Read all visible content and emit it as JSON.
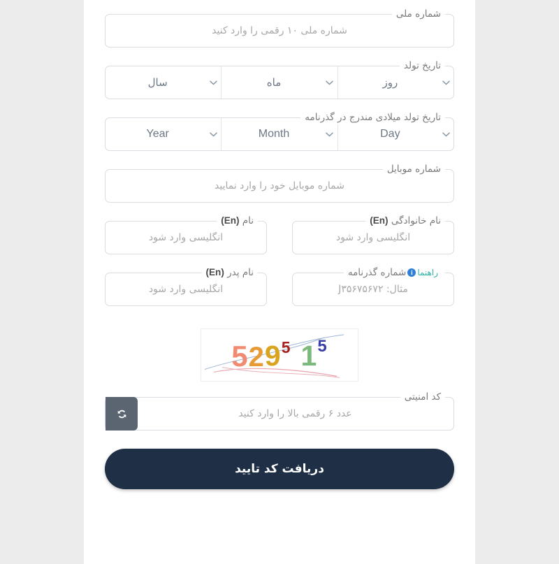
{
  "form": {
    "national_id": {
      "label": "شماره ملی",
      "placeholder": "شماره ملی ۱۰ رقمی را وارد کنید",
      "value": ""
    },
    "birth_date": {
      "label": "تاریخ تولد",
      "day": "روز",
      "month": "ماه",
      "year": "سال"
    },
    "passport_birth_date": {
      "label": "تاریخ تولد میلادی مندرج در گذرنامه",
      "day": "Day",
      "month": "Month",
      "year": "Year"
    },
    "mobile": {
      "label": "شماره موبایل",
      "placeholder": "شماره موبایل خود را وارد نمایید",
      "value": ""
    },
    "first_name_en": {
      "label_fa": "نام ",
      "label_en": "(En)",
      "placeholder": "انگلیسی وارد شود",
      "value": ""
    },
    "last_name_en": {
      "label_fa": "نام خانوادگی ",
      "label_en": "(En)",
      "placeholder": "انگلیسی وارد شود",
      "value": ""
    },
    "father_name_en": {
      "label_fa": "نام پدر ",
      "label_en": "(En)",
      "placeholder": "انگلیسی وارد شود",
      "value": ""
    },
    "passport_number": {
      "label": "شماره گذرنامه",
      "guide_link": "راهنما",
      "guide_icon": "info-circle-icon",
      "placeholder": "مثال: J۳۵۶۷۵۶۷۲",
      "value": ""
    },
    "captcha": {
      "digits": [
        "5",
        "2",
        "9",
        "5",
        "1",
        "5"
      ],
      "text": "529515"
    },
    "security_code": {
      "label": "کد امنیتی",
      "placeholder": "عدد ۶ رقمی بالا را وارد کنید",
      "value": "",
      "refresh_icon": "refresh-icon"
    },
    "submit": {
      "label": "دریافت کد تایید"
    }
  },
  "colors": {
    "page_background": "#ececec",
    "card_background": "#ffffff",
    "border": "#dadde1",
    "label_text": "#7a7a7a",
    "placeholder": "#a8a8a8",
    "select_text": "#6b7785",
    "guide_link": "#2fb3a6",
    "info_icon": "#2f7fd8",
    "refresh_button": "#5b6572",
    "submit_button": "#1e2f46"
  }
}
